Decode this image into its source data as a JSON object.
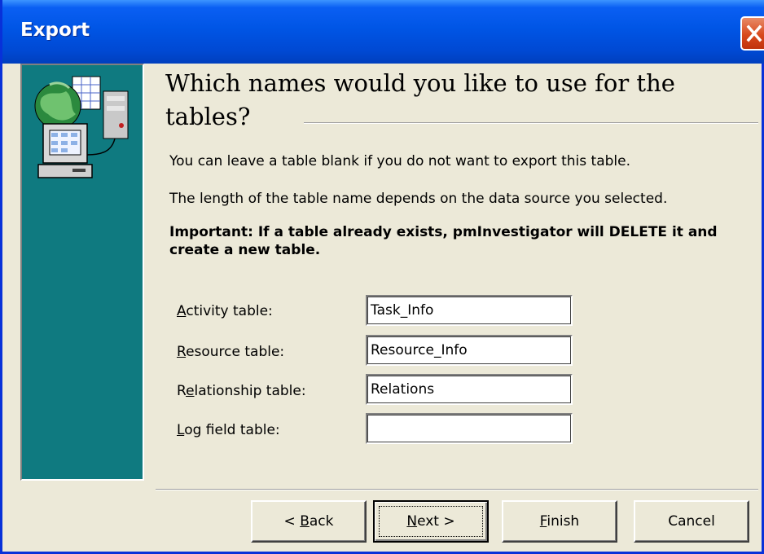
{
  "window": {
    "title": "Export"
  },
  "heading": "Which names would you like to use for the tables?",
  "info": {
    "line1": "You can leave a table blank if you do not want to export this table.",
    "line2": "The length of the table name depends on the data source you selected.",
    "important": "Important: If a table already exists, pmInvestigator will DELETE it and create a new table."
  },
  "fields": [
    {
      "label": "Activity table:",
      "value": "Task_Info"
    },
    {
      "label": "Resource table:",
      "value": "Resource_Info"
    },
    {
      "label": "Relationship table:",
      "value": "Relations"
    },
    {
      "label": "Log field table:",
      "value": ""
    }
  ],
  "buttons": {
    "back": "< Back",
    "next": "Next >",
    "finish": "Finish",
    "cancel": "Cancel"
  },
  "icons": {
    "close": "close-icon",
    "illustration": "computer-network-illustration"
  },
  "colors": {
    "titlebar": "#0055e5",
    "side_panel": "#0f7a80",
    "close": "#d8491c"
  }
}
